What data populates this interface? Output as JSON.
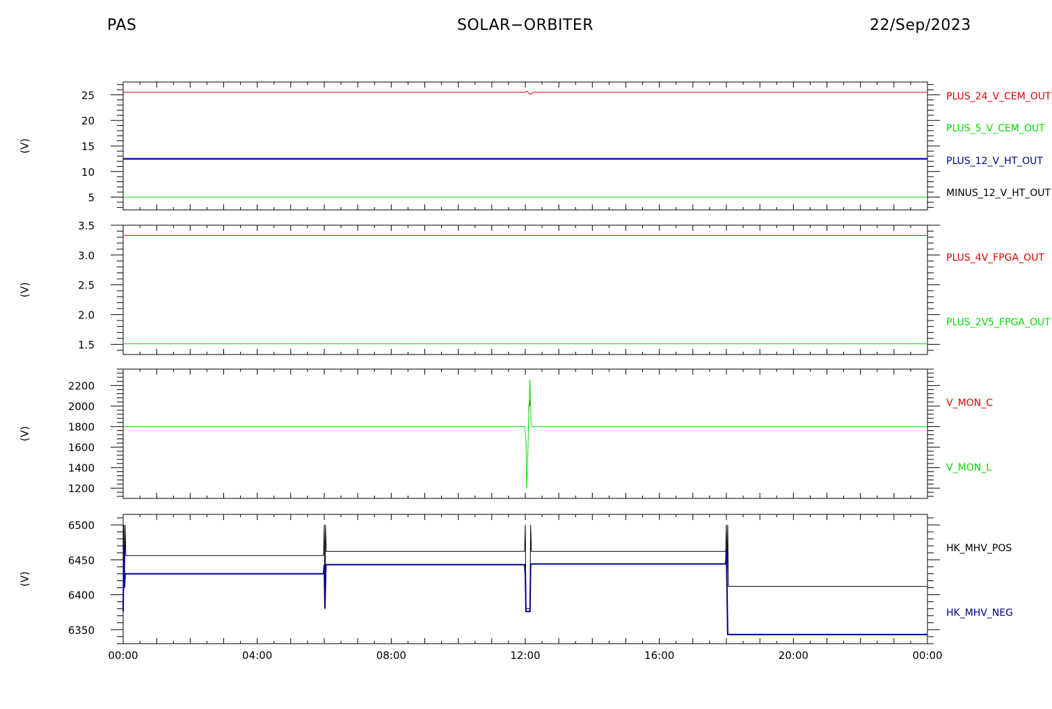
{
  "header": {
    "left": "PAS",
    "center": "SOLAR−ORBITER",
    "right": "22/Sep/2023"
  },
  "chart_data": {
    "type": "line",
    "x_ticks": [
      "00:00",
      "04:00",
      "08:00",
      "12:00",
      "16:00",
      "20:00",
      "00:00"
    ],
    "panels": [
      {
        "ylabel": "(V)",
        "ylim": [
          2.5,
          27.5
        ],
        "yticks": [
          5,
          10,
          15,
          20,
          25
        ],
        "y_tick_labels": [
          "5",
          "10",
          "15",
          "20",
          "25"
        ],
        "legend": [
          {
            "label": "PLUS_24_V_CEM_OUT",
            "color": "#e00000"
          },
          {
            "label": "PLUS_5_V_CEM_OUT",
            "color": "#00dd00"
          },
          {
            "label": "PLUS_12_V_HT_OUT",
            "color": "#00008b"
          },
          {
            "label": "MINUS_12_V_HT_OUT",
            "color": "#000000"
          }
        ],
        "series": [
          {
            "name": "PLUS_24_V_CEM_OUT",
            "color": "#e00000",
            "width": 1,
            "points": [
              [
                0,
                25.5
              ],
              [
                12.0,
                25.5
              ],
              [
                12.05,
                25.7
              ],
              [
                12.15,
                25.1
              ],
              [
                12.25,
                25.5
              ],
              [
                24,
                25.5
              ]
            ]
          },
          {
            "name": "MINUS_12_V_HT_OUT",
            "color": "#000000",
            "width": 1,
            "points": [
              [
                0,
                12.4
              ],
              [
                24,
                12.4
              ]
            ]
          },
          {
            "name": "PLUS_12_V_HT_OUT",
            "color": "#00008b",
            "width": 2,
            "points": [
              [
                0,
                12.5
              ],
              [
                24,
                12.5
              ]
            ]
          },
          {
            "name": "PLUS_5_V_CEM_OUT",
            "color": "#00dd00",
            "width": 1,
            "points": [
              [
                0,
                5.0
              ],
              [
                24,
                5.0
              ]
            ]
          }
        ]
      },
      {
        "ylabel": "(V)",
        "ylim": [
          1.33,
          3.5
        ],
        "yticks": [
          1.5,
          2.0,
          2.5,
          3.0,
          3.5
        ],
        "y_tick_labels": [
          "1.5",
          "2.0",
          "2.5",
          "3.0",
          "3.5"
        ],
        "legend": [
          {
            "label": "PLUS_4V_FPGA_OUT",
            "color": "#e00000"
          },
          {
            "label": "PLUS_2V5_FPGA_OUT",
            "color": "#00dd00"
          }
        ],
        "series": [
          {
            "name": "PLUS_4V_FPGA_OUT",
            "color": "#e00000",
            "width": 1,
            "points": [
              [
                0,
                3.33
              ],
              [
                24,
                3.33
              ]
            ]
          },
          {
            "name": "PLUS_2V5_FPGA_OUT",
            "color": "#00dd00",
            "width": 1,
            "points": [
              [
                0,
                1.51
              ],
              [
                24,
                1.51
              ]
            ]
          }
        ]
      },
      {
        "ylabel": "(V)",
        "ylim": [
          1100,
          2360
        ],
        "yticks": [
          1200,
          1400,
          1600,
          1800,
          2000,
          2200
        ],
        "y_tick_labels": [
          "1200",
          "1400",
          "1600",
          "1800",
          "2000",
          "2200"
        ],
        "legend": [
          {
            "label": "V_MON_C",
            "color": "#e00000"
          },
          {
            "label": "V_MON_L",
            "color": "#00dd00"
          }
        ],
        "series": [
          {
            "name": "V_MON_C",
            "color": "#e00000",
            "width": 1,
            "points": [
              [
                12.1,
                1950
              ],
              [
                12.12,
                2060
              ],
              [
                12.14,
                2000
              ]
            ]
          },
          {
            "name": "V_MON_L",
            "color": "#00dd00",
            "width": 1,
            "points": [
              [
                0,
                1800
              ],
              [
                11.98,
                1800
              ],
              [
                12.02,
                1660
              ],
              [
                12.04,
                1200
              ],
              [
                12.07,
                1450
              ],
              [
                12.1,
                1900
              ],
              [
                12.14,
                2260
              ],
              [
                12.17,
                1850
              ],
              [
                12.2,
                1800
              ],
              [
                24,
                1800
              ]
            ]
          }
        ]
      },
      {
        "ylabel": "(V)",
        "ylim": [
          6330,
          6515
        ],
        "yticks": [
          6350,
          6400,
          6450,
          6500
        ],
        "y_tick_labels": [
          "6350",
          "6400",
          "6450",
          "6500"
        ],
        "legend": [
          {
            "label": "HK_MHV_POS",
            "color": "#000000"
          },
          {
            "label": "HK_MHV_NEG",
            "color": "#00008b"
          }
        ],
        "series": [
          {
            "name": "HK_MHV_POS",
            "color": "#000000",
            "width": 1,
            "points": [
              [
                0,
                6380
              ],
              [
                0.02,
                6500
              ],
              [
                0.04,
                6420
              ],
              [
                0.06,
                6500
              ],
              [
                0.08,
                6456
              ],
              [
                5.98,
                6456
              ],
              [
                6.0,
                6500
              ],
              [
                6.02,
                6390
              ],
              [
                6.04,
                6500
              ],
              [
                6.06,
                6462
              ],
              [
                11.98,
                6462
              ],
              [
                12.0,
                6500
              ],
              [
                12.02,
                6380
              ],
              [
                12.14,
                6380
              ],
              [
                12.16,
                6500
              ],
              [
                12.18,
                6462
              ],
              [
                17.98,
                6462
              ],
              [
                18.0,
                6500
              ],
              [
                18.02,
                6420
              ],
              [
                18.04,
                6500
              ],
              [
                18.06,
                6412
              ],
              [
                24,
                6412
              ]
            ]
          },
          {
            "name": "HK_MHV_NEG",
            "color": "#00008b",
            "width": 2,
            "points": [
              [
                0,
                6376
              ],
              [
                0.02,
                6470
              ],
              [
                0.04,
                6410
              ],
              [
                0.06,
                6430
              ],
              [
                5.98,
                6430
              ],
              [
                6.0,
                6443
              ],
              [
                6.02,
                6380
              ],
              [
                6.05,
                6443
              ],
              [
                11.98,
                6443
              ],
              [
                12.0,
                6430
              ],
              [
                12.02,
                6376
              ],
              [
                12.14,
                6376
              ],
              [
                12.16,
                6444
              ],
              [
                17.98,
                6444
              ],
              [
                18.0,
                6465
              ],
              [
                18.04,
                6343
              ],
              [
                24,
                6343
              ]
            ]
          }
        ]
      }
    ]
  }
}
